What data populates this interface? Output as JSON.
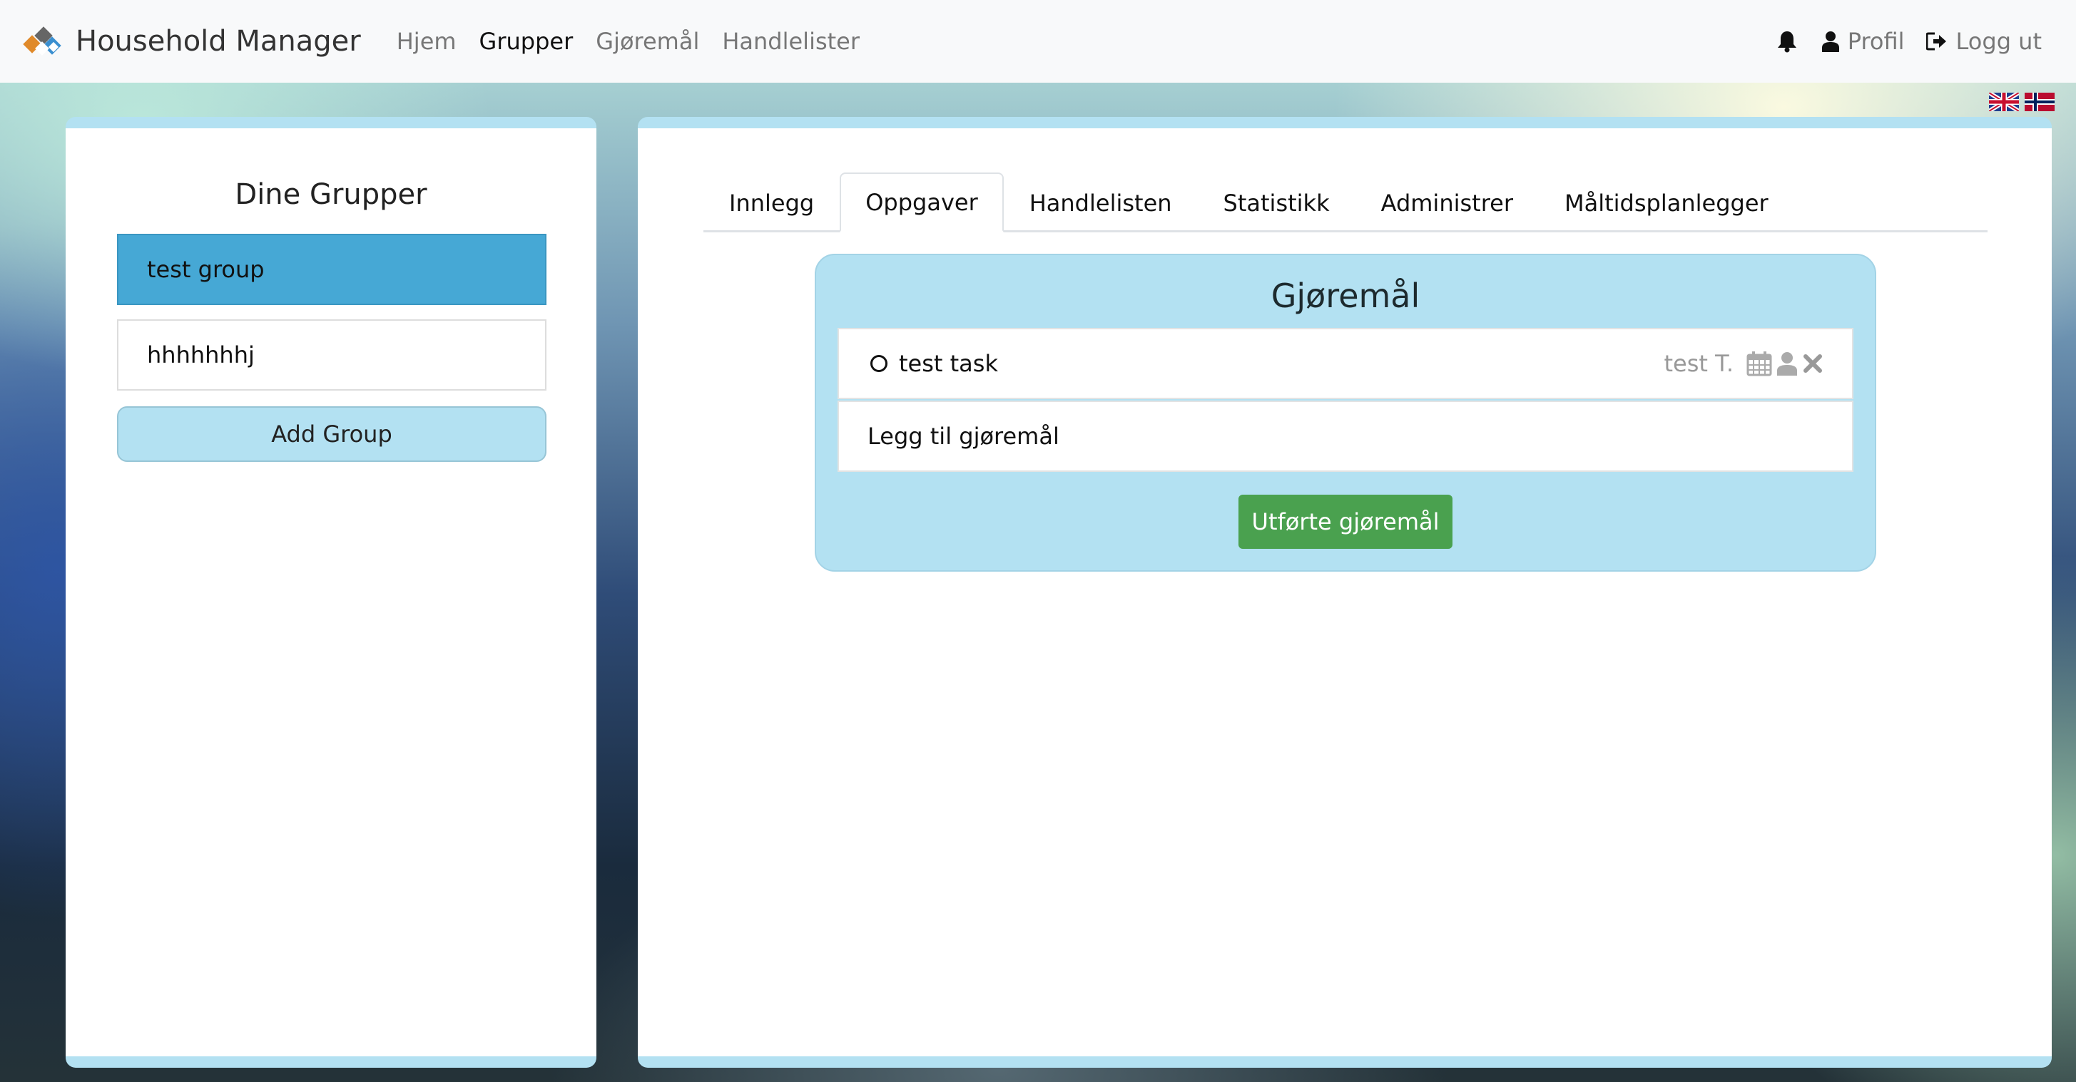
{
  "navbar": {
    "brand": "Household Manager",
    "links": [
      {
        "label": "Hjem",
        "active": false
      },
      {
        "label": "Grupper",
        "active": true
      },
      {
        "label": "Gjøremål",
        "active": false
      },
      {
        "label": "Handlelister",
        "active": false
      }
    ],
    "profile_label": "Profil",
    "logout_label": "Logg ut",
    "icons": [
      "bell-icon",
      "user-icon",
      "sign-out-icon"
    ]
  },
  "languages": [
    "english-flag",
    "norwegian-flag"
  ],
  "groups_panel": {
    "title": "Dine Grupper",
    "groups": [
      {
        "name": "test group",
        "selected": true
      },
      {
        "name": "hhhhhhhj",
        "selected": false
      }
    ],
    "add_group_label": "Add Group"
  },
  "tabs": [
    {
      "label": "Innlegg",
      "active": false
    },
    {
      "label": "Oppgaver",
      "active": true
    },
    {
      "label": "Handlelisten",
      "active": false
    },
    {
      "label": "Statistikk",
      "active": false
    },
    {
      "label": "Administrer",
      "active": false
    },
    {
      "label": "Måltidsplanlegger",
      "active": false
    }
  ],
  "tasks": {
    "title": "Gjøremål",
    "items": [
      {
        "name": "test task",
        "assignee": "test T.",
        "icons": [
          "calendar-icon",
          "user-icon",
          "close-icon"
        ]
      }
    ],
    "add_placeholder": "Legg til gjøremål",
    "completed_button": "Utførte gjøremål"
  },
  "colors": {
    "accent_light": "#b3e1f2",
    "selected_group": "#46a8d5",
    "success": "#4aa14f",
    "navbar_bg": "#f8f9fa"
  }
}
